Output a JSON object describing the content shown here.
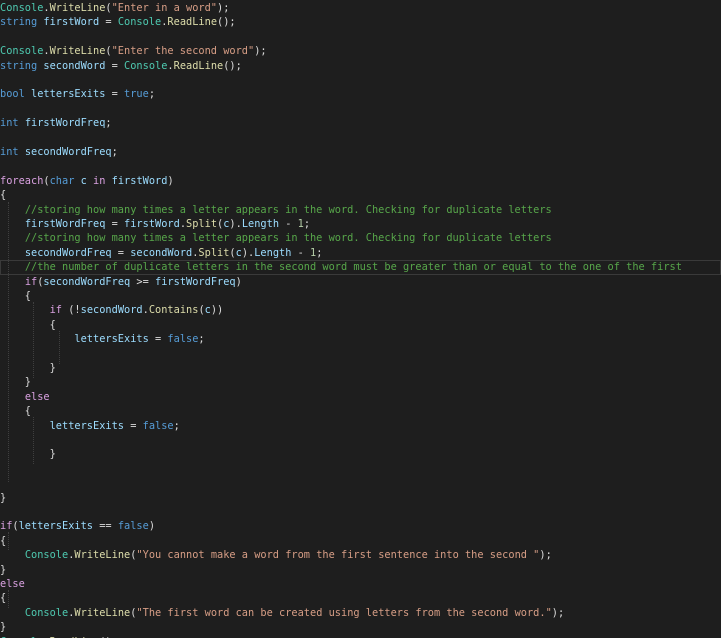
{
  "editor": {
    "lines": [
      [
        {
          "t": "Console",
          "c": "cls"
        },
        {
          "t": ".",
          "c": "pun"
        },
        {
          "t": "WriteLine",
          "c": "mth"
        },
        {
          "t": "(",
          "c": "pun"
        },
        {
          "t": "\"Enter in a word\"",
          "c": "str"
        },
        {
          "t": ");",
          "c": "pun"
        }
      ],
      [
        {
          "t": "string",
          "c": "kw"
        },
        {
          "t": " ",
          "c": "pun"
        },
        {
          "t": "firstWord",
          "c": "var"
        },
        {
          "t": " = ",
          "c": "pun"
        },
        {
          "t": "Console",
          "c": "cls"
        },
        {
          "t": ".",
          "c": "pun"
        },
        {
          "t": "ReadLine",
          "c": "mth"
        },
        {
          "t": "();",
          "c": "pun"
        }
      ],
      [],
      [
        {
          "t": "Console",
          "c": "cls"
        },
        {
          "t": ".",
          "c": "pun"
        },
        {
          "t": "WriteLine",
          "c": "mth"
        },
        {
          "t": "(",
          "c": "pun"
        },
        {
          "t": "\"Enter the second word\"",
          "c": "str"
        },
        {
          "t": ");",
          "c": "pun"
        }
      ],
      [
        {
          "t": "string",
          "c": "kw"
        },
        {
          "t": " ",
          "c": "pun"
        },
        {
          "t": "secondWord",
          "c": "var"
        },
        {
          "t": " = ",
          "c": "pun"
        },
        {
          "t": "Console",
          "c": "cls"
        },
        {
          "t": ".",
          "c": "pun"
        },
        {
          "t": "ReadLine",
          "c": "mth"
        },
        {
          "t": "();",
          "c": "pun"
        }
      ],
      [],
      [
        {
          "t": "bool",
          "c": "kw"
        },
        {
          "t": " ",
          "c": "pun"
        },
        {
          "t": "lettersExits",
          "c": "var"
        },
        {
          "t": " = ",
          "c": "pun"
        },
        {
          "t": "true",
          "c": "kw"
        },
        {
          "t": ";",
          "c": "pun"
        }
      ],
      [],
      [
        {
          "t": "int",
          "c": "kw"
        },
        {
          "t": " ",
          "c": "pun"
        },
        {
          "t": "firstWordFreq",
          "c": "var"
        },
        {
          "t": ";",
          "c": "pun"
        }
      ],
      [],
      [
        {
          "t": "int",
          "c": "kw"
        },
        {
          "t": " ",
          "c": "pun"
        },
        {
          "t": "secondWordFreq",
          "c": "var"
        },
        {
          "t": ";",
          "c": "pun"
        }
      ],
      [],
      [
        {
          "t": "foreach",
          "c": "ctl"
        },
        {
          "t": "(",
          "c": "pun"
        },
        {
          "t": "char",
          "c": "kw"
        },
        {
          "t": " ",
          "c": "pun"
        },
        {
          "t": "c",
          "c": "var"
        },
        {
          "t": " ",
          "c": "pun"
        },
        {
          "t": "in",
          "c": "ctl"
        },
        {
          "t": " ",
          "c": "pun"
        },
        {
          "t": "firstWord",
          "c": "var"
        },
        {
          "t": ")",
          "c": "pun"
        }
      ],
      [
        {
          "t": "{",
          "c": "pun"
        }
      ],
      [
        {
          "t": "    ",
          "c": "pun"
        },
        {
          "t": "//storing how many times a letter appears in the word. Checking for duplicate letters",
          "c": "cmt"
        }
      ],
      [
        {
          "t": "    ",
          "c": "pun"
        },
        {
          "t": "firstWordFreq",
          "c": "var"
        },
        {
          "t": " = ",
          "c": "pun"
        },
        {
          "t": "firstWord",
          "c": "var"
        },
        {
          "t": ".",
          "c": "pun"
        },
        {
          "t": "Split",
          "c": "mth"
        },
        {
          "t": "(",
          "c": "pun"
        },
        {
          "t": "c",
          "c": "var"
        },
        {
          "t": ").",
          "c": "pun"
        },
        {
          "t": "Length",
          "c": "var"
        },
        {
          "t": " - ",
          "c": "pun"
        },
        {
          "t": "1",
          "c": "num"
        },
        {
          "t": ";",
          "c": "pun"
        }
      ],
      [
        {
          "t": "    ",
          "c": "pun"
        },
        {
          "t": "//storing how many times a letter appears in the word. Checking for duplicate letters",
          "c": "cmt"
        }
      ],
      [
        {
          "t": "    ",
          "c": "pun"
        },
        {
          "t": "secondWordFreq",
          "c": "var"
        },
        {
          "t": " = ",
          "c": "pun"
        },
        {
          "t": "secondWord",
          "c": "var"
        },
        {
          "t": ".",
          "c": "pun"
        },
        {
          "t": "Split",
          "c": "mth"
        },
        {
          "t": "(",
          "c": "pun"
        },
        {
          "t": "c",
          "c": "var"
        },
        {
          "t": ").",
          "c": "pun"
        },
        {
          "t": "Length",
          "c": "var"
        },
        {
          "t": " - ",
          "c": "pun"
        },
        {
          "t": "1",
          "c": "num"
        },
        {
          "t": ";",
          "c": "pun"
        }
      ],
      [
        {
          "t": "    ",
          "c": "pun"
        },
        {
          "t": "//the number of duplicate letters in the second word must be greater than or equal to the one of the first",
          "c": "cmt"
        }
      ],
      [
        {
          "t": "    ",
          "c": "pun"
        },
        {
          "t": "if",
          "c": "ctl"
        },
        {
          "t": "(",
          "c": "pun"
        },
        {
          "t": "secondWordFreq",
          "c": "var"
        },
        {
          "t": " >= ",
          "c": "pun"
        },
        {
          "t": "firstWordFreq",
          "c": "var"
        },
        {
          "t": ")",
          "c": "pun"
        }
      ],
      [
        {
          "t": "    {",
          "c": "pun"
        }
      ],
      [
        {
          "t": "        ",
          "c": "pun"
        },
        {
          "t": "if",
          "c": "ctl"
        },
        {
          "t": " (!",
          "c": "pun"
        },
        {
          "t": "secondWord",
          "c": "var"
        },
        {
          "t": ".",
          "c": "pun"
        },
        {
          "t": "Contains",
          "c": "mth"
        },
        {
          "t": "(",
          "c": "pun"
        },
        {
          "t": "c",
          "c": "var"
        },
        {
          "t": "))",
          "c": "pun"
        }
      ],
      [
        {
          "t": "        {",
          "c": "pun"
        }
      ],
      [
        {
          "t": "            ",
          "c": "pun"
        },
        {
          "t": "lettersExits",
          "c": "var"
        },
        {
          "t": " = ",
          "c": "pun"
        },
        {
          "t": "false",
          "c": "kw"
        },
        {
          "t": ";",
          "c": "pun"
        }
      ],
      [],
      [
        {
          "t": "        }",
          "c": "pun"
        }
      ],
      [
        {
          "t": "    }",
          "c": "pun"
        }
      ],
      [
        {
          "t": "    ",
          "c": "pun"
        },
        {
          "t": "else",
          "c": "ctl"
        }
      ],
      [
        {
          "t": "    {",
          "c": "pun"
        }
      ],
      [
        {
          "t": "        ",
          "c": "pun"
        },
        {
          "t": "lettersExits",
          "c": "var"
        },
        {
          "t": " = ",
          "c": "pun"
        },
        {
          "t": "false",
          "c": "kw"
        },
        {
          "t": ";",
          "c": "pun"
        }
      ],
      [],
      [
        {
          "t": "        }",
          "c": "pun"
        }
      ],
      [],
      [],
      [
        {
          "t": "}",
          "c": "pun"
        }
      ],
      [],
      [
        {
          "t": "if",
          "c": "ctl"
        },
        {
          "t": "(",
          "c": "pun"
        },
        {
          "t": "lettersExits",
          "c": "var"
        },
        {
          "t": " == ",
          "c": "pun"
        },
        {
          "t": "false",
          "c": "kw"
        },
        {
          "t": ")",
          "c": "pun"
        }
      ],
      [
        {
          "t": "{",
          "c": "pun"
        }
      ],
      [
        {
          "t": "    ",
          "c": "pun"
        },
        {
          "t": "Console",
          "c": "cls"
        },
        {
          "t": ".",
          "c": "pun"
        },
        {
          "t": "WriteLine",
          "c": "mth"
        },
        {
          "t": "(",
          "c": "pun"
        },
        {
          "t": "\"You cannot make a word from the first sentence into the second \"",
          "c": "str"
        },
        {
          "t": ");",
          "c": "pun"
        }
      ],
      [
        {
          "t": "}",
          "c": "pun"
        }
      ],
      [
        {
          "t": "else",
          "c": "ctl"
        }
      ],
      [
        {
          "t": "{",
          "c": "pun"
        }
      ],
      [
        {
          "t": "    ",
          "c": "pun"
        },
        {
          "t": "Console",
          "c": "cls"
        },
        {
          "t": ".",
          "c": "pun"
        },
        {
          "t": "WriteLine",
          "c": "mth"
        },
        {
          "t": "(",
          "c": "pun"
        },
        {
          "t": "\"The first word can be created using letters from the second word.\"",
          "c": "str"
        },
        {
          "t": ");",
          "c": "pun"
        }
      ],
      [
        {
          "t": "}",
          "c": "pun"
        }
      ],
      [
        {
          "t": "Console",
          "c": "cls"
        },
        {
          "t": ".",
          "c": "pun"
        },
        {
          "t": "ReadLine",
          "c": "mth"
        },
        {
          "t": "();",
          "c": "pun"
        }
      ]
    ],
    "current_line": 18
  }
}
